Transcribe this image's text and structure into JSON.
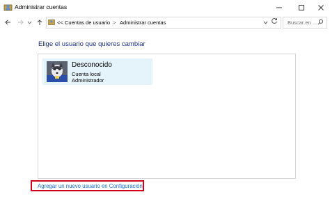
{
  "window": {
    "title": "Administrar cuentas",
    "app_icon": "user-accounts-icon",
    "controls": {
      "minimize": "minimize-icon",
      "maximize": "maximize-icon",
      "close": "close-icon"
    }
  },
  "address_bar": {
    "back_icon": "back-arrow-icon",
    "forward_icon": "forward-arrow-icon",
    "recent_icon": "chevron-down-icon",
    "up_icon": "up-arrow-icon",
    "overflow": "<<",
    "breadcrumbs": [
      "Cuentas de usuario",
      "Administrar cuentas"
    ],
    "separator": ">",
    "dropdown_icon": "chevron-down-icon",
    "refresh_icon": "refresh-icon"
  },
  "search": {
    "placeholder": "Buscar en ..."
  },
  "main": {
    "heading": "Elige el usuario que quieres cambiar",
    "user": {
      "name": "Desconocido",
      "type": "Cuenta local",
      "role": "Administrador"
    },
    "add_user_link": "Agregar un nuevo usuario en Configuración"
  },
  "colors": {
    "heading": "#1e3287",
    "link": "#1a6fcf",
    "tile_bg": "#e5f3fb",
    "highlight_border": "#d0021b"
  }
}
